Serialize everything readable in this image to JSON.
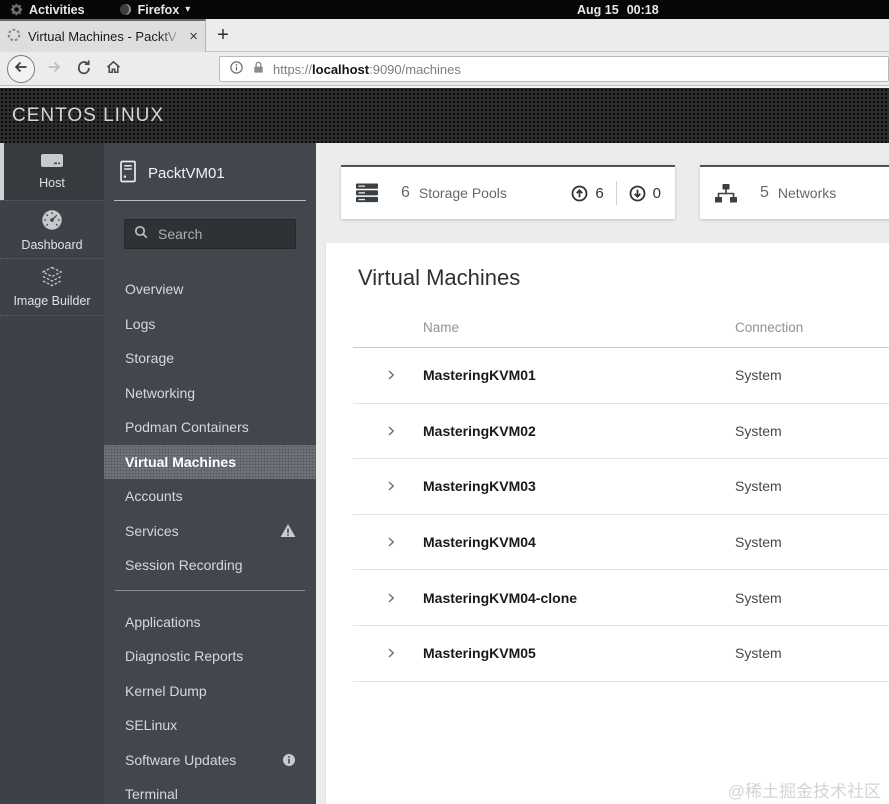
{
  "desktop": {
    "activities_label": "Activities",
    "app_menu_label": "Firefox",
    "clock_date": "Aug 15",
    "clock_time": "00:18"
  },
  "browser": {
    "tab_title": "Virtual Machines - PacktV",
    "url_scheme": "https://",
    "url_host": "localhost",
    "url_path": ":9090/machines"
  },
  "banner": {
    "title": "CENTOS LINUX"
  },
  "primary_nav": {
    "items": [
      {
        "label": "Host",
        "selected": true
      },
      {
        "label": "Dashboard",
        "selected": false
      },
      {
        "label": "Image Builder",
        "selected": false
      }
    ]
  },
  "secondary_nav": {
    "host_name": "PacktVM01",
    "search_placeholder": "Search",
    "items": [
      {
        "label": "Overview"
      },
      {
        "label": "Logs"
      },
      {
        "label": "Storage"
      },
      {
        "label": "Networking"
      },
      {
        "label": "Podman Containers"
      },
      {
        "label": "Virtual Machines",
        "selected": true
      },
      {
        "label": "Accounts"
      },
      {
        "label": "Services",
        "badge": "warning"
      },
      {
        "label": "Session Recording"
      }
    ],
    "tools_items": [
      {
        "label": "Applications"
      },
      {
        "label": "Diagnostic Reports"
      },
      {
        "label": "Kernel Dump"
      },
      {
        "label": "SELinux"
      },
      {
        "label": "Software Updates",
        "badge": "info"
      },
      {
        "label": "Terminal"
      }
    ]
  },
  "summary_cards": [
    {
      "count": "6",
      "label": "Storage Pools",
      "active_count": "6",
      "inactive_count": "0"
    },
    {
      "count": "5",
      "label": "Networks"
    }
  ],
  "vm_panel": {
    "title": "Virtual Machines",
    "columns": {
      "name": "Name",
      "connection": "Connection"
    },
    "rows": [
      {
        "name": "MasteringKVM01",
        "connection": "System"
      },
      {
        "name": "MasteringKVM02",
        "connection": "System"
      },
      {
        "name": "MasteringKVM03",
        "connection": "System"
      },
      {
        "name": "MasteringKVM04",
        "connection": "System"
      },
      {
        "name": "MasteringKVM04-clone",
        "connection": "System"
      },
      {
        "name": "MasteringKVM05",
        "connection": "System"
      }
    ]
  },
  "watermark": "@稀土掘金技术社区",
  "icons": {
    "activities": "gear",
    "firefox": "circle-swirl",
    "firefox_caret": "▾",
    "tab_loading": "spinner",
    "tab_close": "×",
    "new_tab": "+",
    "back": "arrow-left-circle",
    "forward": "arrow-right",
    "reload": "refresh-arrow",
    "home": "house",
    "page_info": "circle-i",
    "tls_lock": "padlock",
    "host": "server",
    "dashboard": "gauge",
    "image_builder": "layers",
    "vm_host": "server-tower",
    "search": "magnifier",
    "warning": "triangle-exclamation",
    "info": "circle-info",
    "storage_pools": "server-stack",
    "network": "network-tree",
    "active_up": "arrow-up-circle",
    "inactive_down": "arrow-down-circle",
    "row_expand": "chevron-right"
  },
  "colors": {
    "top_bar_bg": "#070707",
    "banner_bg": "#2d2d2d",
    "sidebar_primary_bg": "#3c4247",
    "sidebar_secondary_bg": "#41474c",
    "selected_item_bg": "#70767c",
    "card_top_border": "#4f545a",
    "page_bg": "#ececec"
  }
}
